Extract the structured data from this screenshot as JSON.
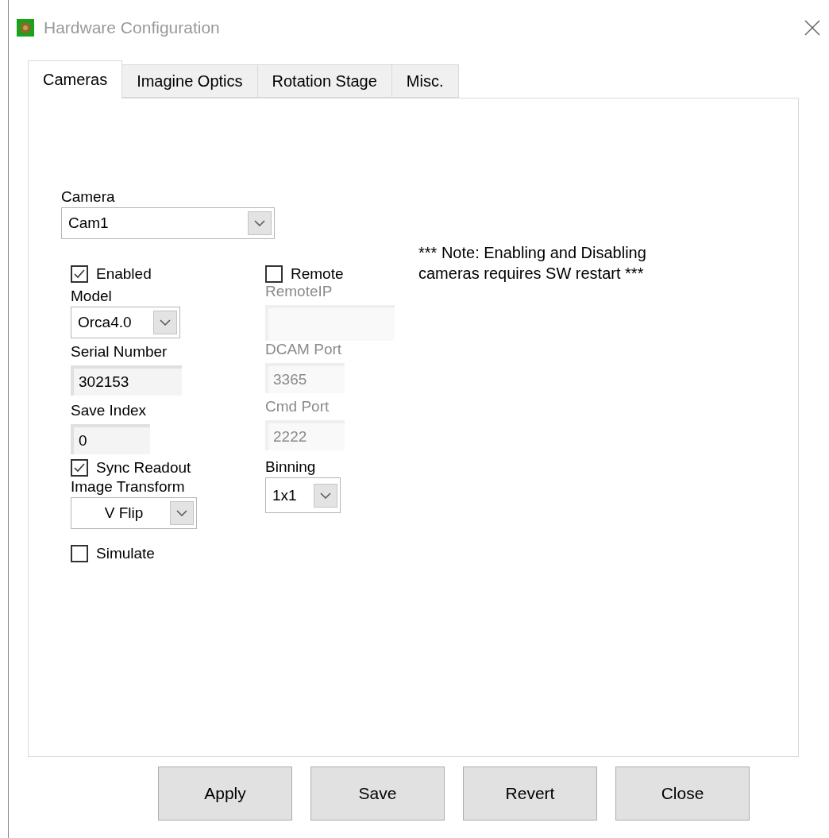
{
  "window": {
    "title": "Hardware Configuration"
  },
  "tabs": [
    {
      "label": "Cameras",
      "selected": true
    },
    {
      "label": "Imagine Optics",
      "selected": false
    },
    {
      "label": "Rotation Stage",
      "selected": false
    },
    {
      "label": "Misc.",
      "selected": false
    }
  ],
  "camera": {
    "label": "Camera",
    "value": "Cam1"
  },
  "note": "*** Note: Enabling and Disabling cameras requires SW restart ***",
  "left_controls": [
    {
      "kind": "checkbox",
      "label": "Enabled",
      "checked": true
    },
    {
      "kind": "dropdown",
      "label": "Model",
      "value": "Orca4.0"
    },
    {
      "kind": "textbox",
      "label": "Serial Number",
      "value": "302153",
      "disabled": false
    },
    {
      "kind": "textbox",
      "label": "Save Index",
      "value": "0",
      "disabled": false
    },
    {
      "kind": "checkbox",
      "label": "Sync Readout",
      "checked": true
    },
    {
      "kind": "dropdown",
      "label": "Image Transform",
      "value": "V Flip"
    },
    {
      "kind": "checkbox",
      "label": "Simulate",
      "checked": false
    }
  ],
  "right_controls": [
    {
      "kind": "checkbox",
      "label": "Remote",
      "checked": false
    },
    {
      "kind": "textbox",
      "label": "RemoteIP",
      "disabled": true
    },
    {
      "kind": "textbox",
      "label": "DCAM Port",
      "value": "3365",
      "disabled": true
    },
    {
      "kind": "textbox",
      "label": "Cmd Port",
      "value": "2222",
      "disabled": true
    },
    {
      "kind": "dropdown",
      "label": "Binning",
      "value": "1x1"
    }
  ],
  "buttons": [
    "Apply",
    "Save",
    "Revert",
    "Close"
  ]
}
